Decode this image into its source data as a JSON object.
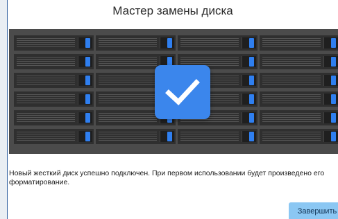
{
  "dialog": {
    "title": "Мастер замены диска",
    "message": "Новый жесткий диск успешно подключен. При первом использовании будет произведено его форматирование.",
    "finish_label": "Завершить"
  },
  "rack": {
    "columns": 4,
    "rows": 6,
    "led_color": "#2f7ff0",
    "led_on": [
      [
        true,
        true,
        true,
        true
      ],
      [
        true,
        true,
        true,
        true
      ],
      [
        true,
        false,
        true,
        true
      ],
      [
        true,
        true,
        true,
        true
      ],
      [
        true,
        true,
        true,
        true
      ],
      [
        true,
        true,
        true,
        true
      ]
    ]
  },
  "status_icon": "checkmark-icon",
  "colors": {
    "accent": "#3b86ec",
    "button": "#8bc7f3",
    "rack_background": "#4b4b4b"
  }
}
